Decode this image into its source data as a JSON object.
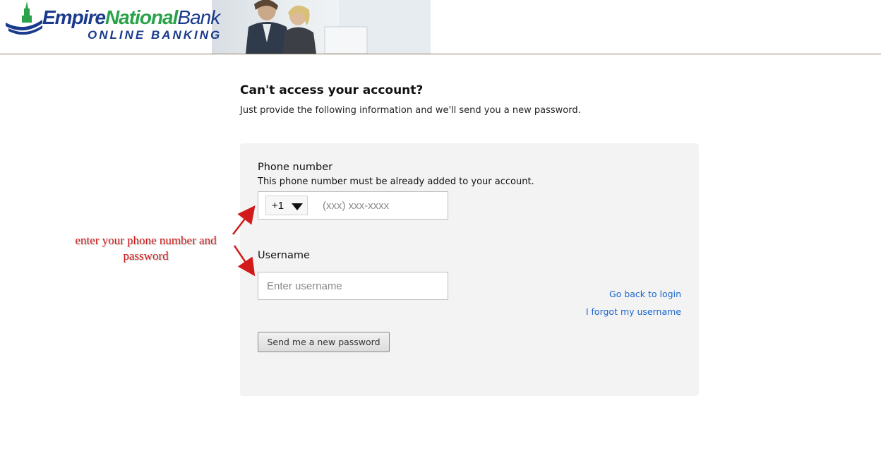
{
  "header": {
    "brand_empire": "Empire",
    "brand_national": "National",
    "brand_bank": "Bank",
    "brand_subtitle": "ONLINE BANKING"
  },
  "page": {
    "title": "Can't access your account?",
    "subtitle": "Just provide the following information and we'll send you a new password."
  },
  "form": {
    "phone_label": "Phone number",
    "phone_hint": "This phone number must be already added to your account.",
    "country_code": "+1",
    "phone_placeholder": "(xxx) xxx-xxxx",
    "username_label": "Username",
    "username_placeholder": "Enter username",
    "submit_label": "Send me a new password"
  },
  "links": {
    "back_to_login": "Go back to login",
    "forgot_username": "I forgot my username"
  },
  "annotation": {
    "text": "enter your phone number and password"
  },
  "colors": {
    "brand_blue": "#1a3a8c",
    "brand_green": "#2aa24a",
    "link": "#1a66cc",
    "annotation_red": "#d21a1a",
    "panel_bg": "#f3f3f3"
  },
  "icons": {
    "logo": "bank-building-wave-icon",
    "caret": "chevron-down-icon",
    "arrows": "red-arrow-icon"
  }
}
